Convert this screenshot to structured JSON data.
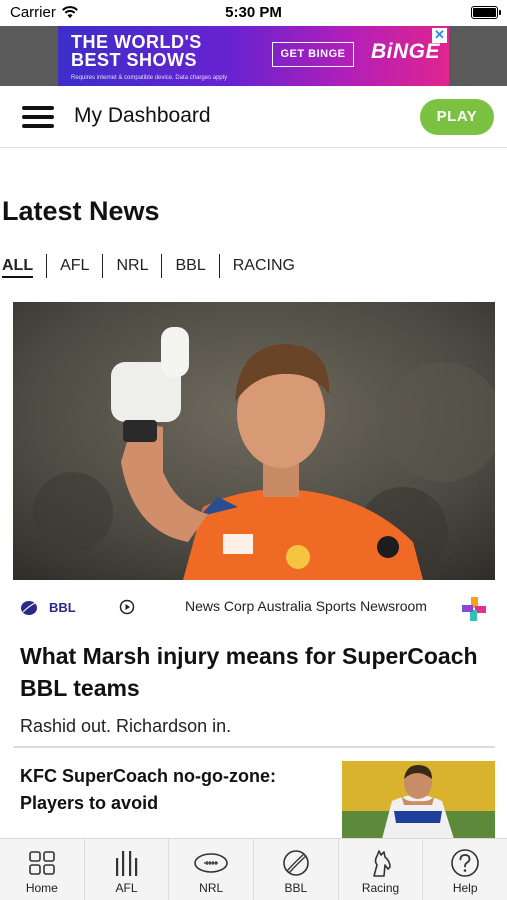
{
  "status_bar": {
    "carrier": "Carrier",
    "time": "5:30 PM"
  },
  "ad": {
    "headline_line1": "THE WORLD'S",
    "headline_line2": "BEST SHOWS",
    "cta": "GET BINGE",
    "brand": "BiNGE",
    "fine_print": "Requires internet & compatible device. Data charges apply",
    "close_symbol": "✕"
  },
  "header": {
    "title": "My Dashboard",
    "play_label": "PLAY",
    "accent_color": "#7cc242"
  },
  "latest_news": {
    "title": "Latest News",
    "filters": [
      "ALL",
      "AFL",
      "NRL",
      "BBL",
      "RACING"
    ],
    "active_filter": "ALL"
  },
  "featured_article": {
    "category": "BBL",
    "source": "News Corp Australia Sports Newsroom",
    "title": "What Marsh injury means for SuperCoach BBL teams",
    "summary": "Rashid out. Richardson in.",
    "category_color": "#2b2a8a"
  },
  "second_article": {
    "title": "KFC SuperCoach no-go-zone: Players to avoid"
  },
  "tab_bar": {
    "items": [
      {
        "label": "Home",
        "icon": "home-grid-icon"
      },
      {
        "label": "AFL",
        "icon": "afl-icon"
      },
      {
        "label": "NRL",
        "icon": "nrl-football-icon"
      },
      {
        "label": "BBL",
        "icon": "cricket-ball-icon"
      },
      {
        "label": "Racing",
        "icon": "horse-icon"
      },
      {
        "label": "Help",
        "icon": "help-icon"
      }
    ]
  }
}
